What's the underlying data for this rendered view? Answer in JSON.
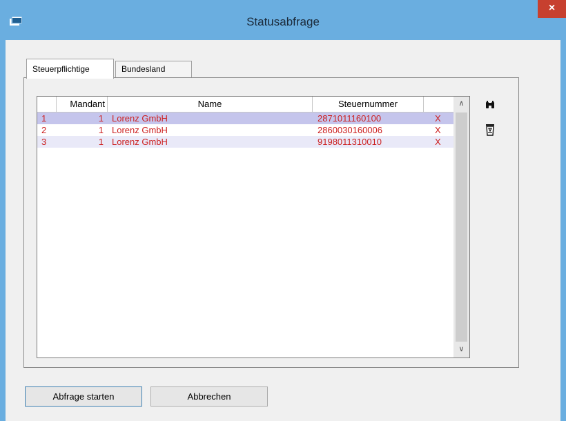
{
  "window": {
    "title": "Statusabfrage",
    "close_label": "×"
  },
  "tabs": [
    {
      "label": "Steuerpflichtige",
      "active": true
    },
    {
      "label": "Bundesland",
      "active": false
    }
  ],
  "grid": {
    "columns": [
      "",
      "Mandant",
      "Name",
      "Steuernummer",
      ""
    ],
    "rows": [
      {
        "num": "1",
        "mandant": "1",
        "name": "Lorenz GmbH",
        "steuernummer": "2871011160100",
        "delete": "X",
        "selected": true
      },
      {
        "num": "2",
        "mandant": "1",
        "name": "Lorenz GmbH",
        "steuernummer": "2860030160006",
        "delete": "X",
        "selected": false
      },
      {
        "num": "3",
        "mandant": "1",
        "name": "Lorenz GmbH",
        "steuernummer": "9198011310010",
        "delete": "X",
        "selected": false
      }
    ],
    "scroll_up": "∧",
    "scroll_down": "∨"
  },
  "side_buttons": {
    "find_icon": "binoculars-icon",
    "delete_icon": "recycle-bin-icon"
  },
  "buttons": {
    "start_label": "Abfrage starten",
    "cancel_label": "Abbrechen"
  },
  "colors": {
    "title_bar": "#6aaee0",
    "close_button": "#c7402f",
    "row_text": "#cc1f1f",
    "selected_row": "#c5c5ec"
  }
}
